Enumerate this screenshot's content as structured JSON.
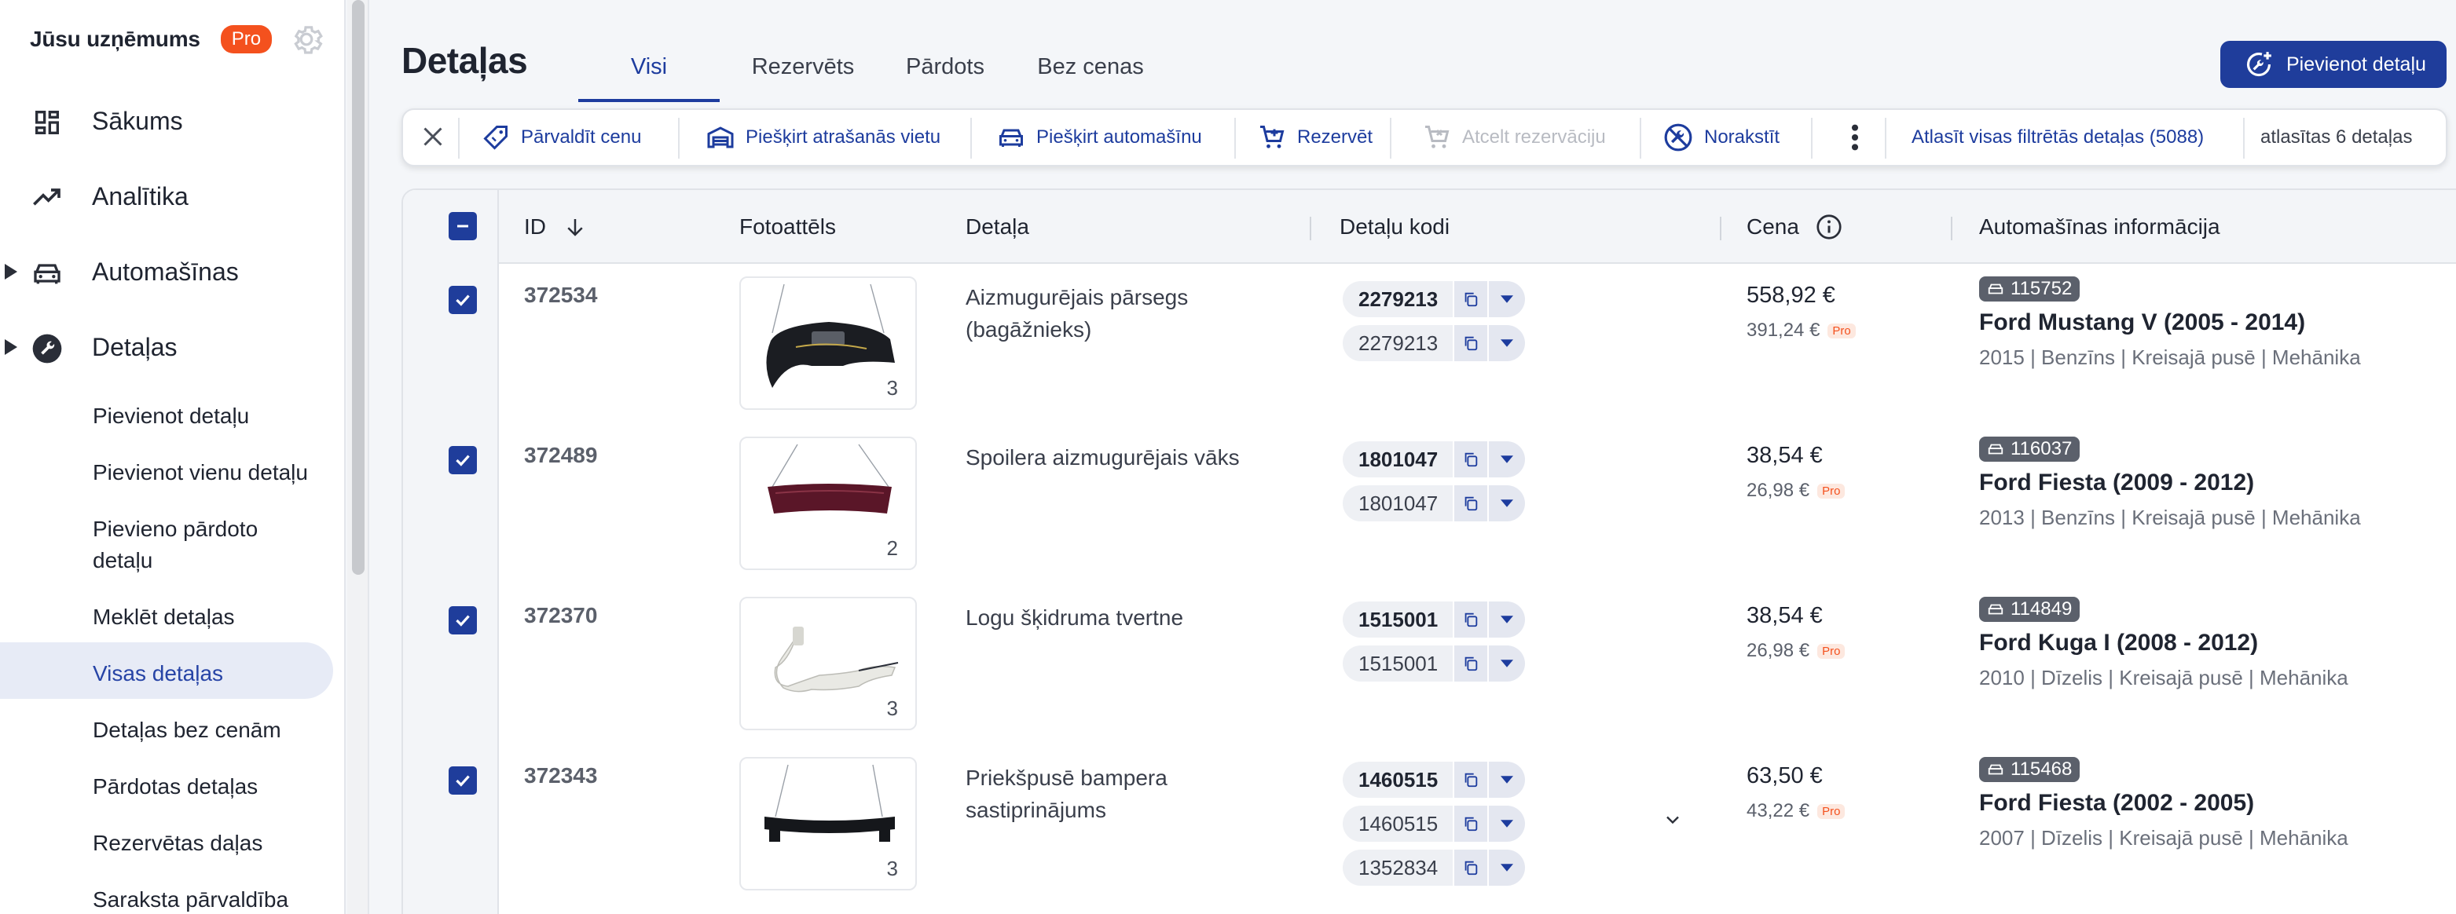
{
  "company": {
    "name": "Jūsu uzņēmums",
    "badge": "Pro"
  },
  "nav": {
    "main": [
      {
        "label": "Sākums"
      },
      {
        "label": "Analītika"
      },
      {
        "label": "Automašīnas"
      },
      {
        "label": "Detaļas"
      }
    ],
    "sub": [
      {
        "label": "Pievienot detaļu"
      },
      {
        "label": "Pievienot vienu detaļu"
      },
      {
        "label": "Pievieno pārdoto detaļu"
      },
      {
        "label": "Meklēt detaļas"
      },
      {
        "label": "Visas detaļas"
      },
      {
        "label": "Detaļas bez cenām"
      },
      {
        "label": "Pārdotas detaļas"
      },
      {
        "label": "Rezervētas daļas"
      },
      {
        "label": "Saraksta pārvaldība"
      }
    ]
  },
  "header": {
    "title": "Detaļas",
    "tabs": [
      {
        "label": "Visi"
      },
      {
        "label": "Rezervēts"
      },
      {
        "label": "Pārdots"
      },
      {
        "label": "Bez cenas"
      }
    ],
    "add_button": "Pievienot detaļu"
  },
  "actions": {
    "reprice": "Pārvaldīt cenu",
    "assign_location": "Piešķirt atrašanās vietu",
    "assign_car": "Piešķirt automašīnu",
    "reserve": "Rezervēt",
    "cancel_reservation": "Atcelt rezervāciju",
    "write_off": "Norakstīt",
    "select_all_filtered": "Atlasīt visas filtrētās detaļas (5088)",
    "selected_count": "atlasītas 6 detaļas"
  },
  "table": {
    "columns": {
      "id": "ID",
      "photo": "Fotoattēls",
      "part": "Detaļa",
      "codes": "Detaļu kodi",
      "price": "Cena",
      "car": "Automašīnas informācija"
    },
    "rows": [
      {
        "id": "372534",
        "photo_count": "3",
        "part": "Aizmugurējais pārsegs (bagāžnieks)",
        "codes": [
          "2279213",
          "2279213"
        ],
        "price": "558,92 €",
        "pro_price": "391,24 €",
        "pro_tag": "Pro",
        "car_id": "115752",
        "car_model": "Ford Mustang V (2005 - 2014)",
        "car_meta": "2015 | Benzīns | Kreisajā pusē | Mehānika"
      },
      {
        "id": "372489",
        "photo_count": "2",
        "part": "Spoilera aizmugurējais vāks",
        "codes": [
          "1801047",
          "1801047"
        ],
        "price": "38,54 €",
        "pro_price": "26,98 €",
        "pro_tag": "Pro",
        "car_id": "116037",
        "car_model": "Ford Fiesta (2009 - 2012)",
        "car_meta": "2013 | Benzīns | Kreisajā pusē | Mehānika"
      },
      {
        "id": "372370",
        "photo_count": "3",
        "part": "Logu šķidruma tvertne",
        "codes": [
          "1515001",
          "1515001"
        ],
        "price": "38,54 €",
        "pro_price": "26,98 €",
        "pro_tag": "Pro",
        "car_id": "114849",
        "car_model": "Ford Kuga I (2008 - 2012)",
        "car_meta": "2010 | Dīzelis | Kreisajā pusē | Mehānika"
      },
      {
        "id": "372343",
        "photo_count": "3",
        "part": "Priekšpusē bampera sastiprinājums",
        "codes": [
          "1460515",
          "1460515",
          "1352834"
        ],
        "price": "63,50 €",
        "pro_price": "43,22 €",
        "pro_tag": "Pro",
        "car_id": "115468",
        "car_model": "Ford Fiesta (2002 - 2005)",
        "car_meta": "2007 | Dīzelis | Kreisajā pusē | Mehānika"
      }
    ]
  },
  "colors": {
    "primary": "#1f3d9b",
    "accent": "#f4511e",
    "active_bg": "#e7ebf6"
  }
}
